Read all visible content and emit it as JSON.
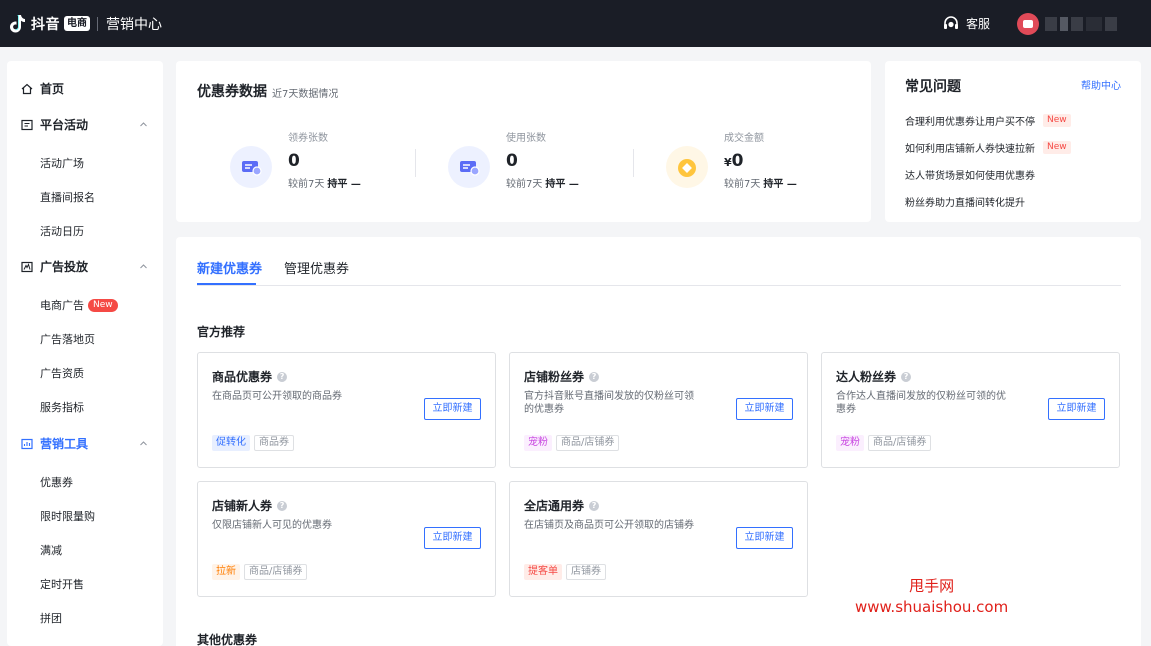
{
  "header": {
    "logo_text": "抖音",
    "logo_badge": "电商",
    "app_name": "营销中心",
    "service_label": "客服"
  },
  "sidebar": {
    "home": "首页",
    "group_platform": "平台活动",
    "platform_items": [
      "活动广场",
      "直播间报名",
      "活动日历"
    ],
    "group_ads": "广告投放",
    "ads_items": [
      "电商广告",
      "广告落地页",
      "广告资质",
      "服务指标"
    ],
    "ads_new_badge": "New",
    "group_tools": "营销工具",
    "tools_items": [
      "优惠券",
      "限时限量购",
      "满减",
      "定时开售",
      "拼团"
    ]
  },
  "stats": {
    "title": "优惠券数据",
    "subtitle": "近7天数据情况",
    "items": [
      {
        "label": "领券张数",
        "value": "0",
        "currency": "",
        "compare_label": "较前7天",
        "compare_value": "持平 —"
      },
      {
        "label": "使用张数",
        "value": "0",
        "currency": "",
        "compare_label": "较前7天",
        "compare_value": "持平 —"
      },
      {
        "label": "成交金额",
        "value": "0",
        "currency": "¥",
        "compare_label": "较前7天",
        "compare_value": "持平 —"
      }
    ]
  },
  "faq": {
    "title": "常见问题",
    "help_link": "帮助中心",
    "items": [
      {
        "text": "合理利用优惠券让用户买不停",
        "badge": "New"
      },
      {
        "text": "如何利用店铺新人券快速拉新",
        "badge": "New"
      },
      {
        "text": "达人带货场景如何使用优惠券",
        "badge": ""
      },
      {
        "text": "粉丝券助力直播间转化提升",
        "badge": ""
      }
    ]
  },
  "tabs": {
    "create": "新建优惠券",
    "manage": "管理优惠券"
  },
  "official": {
    "title": "官方推荐",
    "button_label": "立即新建",
    "coupons": [
      {
        "title": "商品优惠券",
        "desc": "在商品页可公开领取的商品券",
        "tag": "促转化",
        "scope": "商品券"
      },
      {
        "title": "店铺粉丝券",
        "desc": "官方抖音账号直播间发放的仅粉丝可领的优惠券",
        "tag": "宠粉",
        "scope": "商品/店铺券"
      },
      {
        "title": "达人粉丝券",
        "desc": "合作达人直播间发放的仅粉丝可领的优惠券",
        "tag": "宠粉",
        "scope": "商品/店铺券"
      },
      {
        "title": "店铺新人券",
        "desc": "仅限店铺新人可见的优惠券",
        "tag": "拉新",
        "scope": "商品/店铺券"
      },
      {
        "title": "全店通用券",
        "desc": "在店铺页及商品页可公开领取的店铺券",
        "tag": "提客单",
        "scope": "店铺券"
      }
    ]
  },
  "other": {
    "title": "其他优惠券"
  },
  "watermark": {
    "line1": "甩手网",
    "line2": "www.shuaishou.com"
  },
  "colors": {
    "accent": "#3370ff",
    "topbar": "#1a1d26",
    "new_badge": "#f54a45"
  }
}
